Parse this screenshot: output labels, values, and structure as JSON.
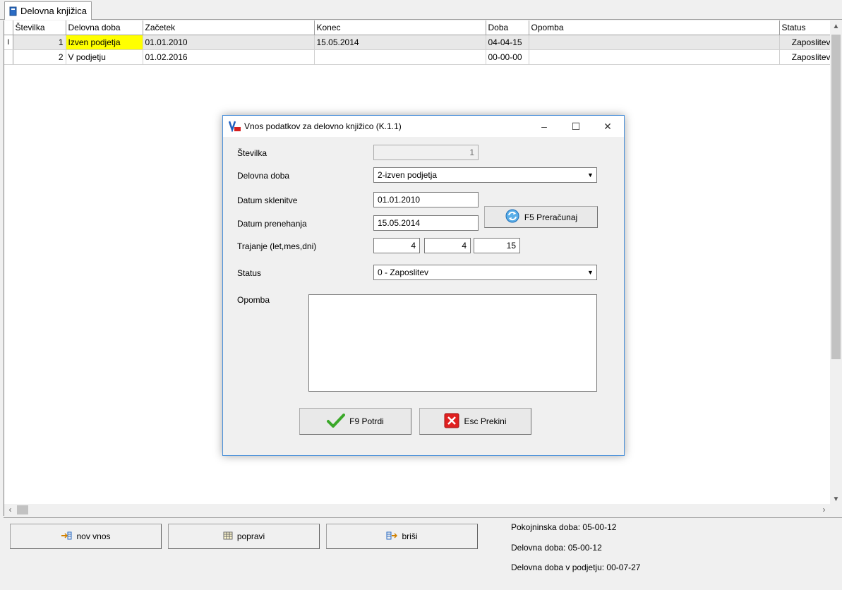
{
  "tab": {
    "label": "Delovna knjižica"
  },
  "grid": {
    "columns": [
      "Številka",
      "Delovna doba",
      "Začetek",
      "Konec",
      "Doba",
      "Opomba",
      "Status"
    ],
    "rows": [
      {
        "indicator": "I",
        "stevilka": "1",
        "delovna_doba": "Izven podjetja",
        "zacetek": "01.01.2010",
        "konec": "15.05.2014",
        "doba": "04-04-15",
        "opomba": "",
        "status": "Zaposlitev"
      },
      {
        "indicator": "",
        "stevilka": "2",
        "delovna_doba": "V podjetju",
        "zacetek": "01.02.2016",
        "konec": "",
        "doba": "00-00-00",
        "opomba": "",
        "status": "Zaposlitev"
      }
    ]
  },
  "bottom": {
    "btn_new": "nov vnos",
    "btn_edit": "popravi",
    "btn_delete": "briši",
    "pokojninska": "Pokojninska doba: 05-00-12",
    "delovna": "Delovna doba: 05-00-12",
    "delovna_podjetje": "Delovna doba v podjetju: 00-07-27"
  },
  "dialog": {
    "title": "Vnos podatkov za delovno knjižico  (K.1.1)",
    "lbl_stevilka": "Številka",
    "val_stevilka": "1",
    "lbl_delovna_doba": "Delovna doba",
    "val_delovna_doba": "2-izven podjetja",
    "lbl_datum_sklenitve": "Datum sklenitve",
    "val_datum_sklenitve": "01.01.2010",
    "lbl_datum_prenehanja": "Datum prenehanja",
    "val_datum_prenehanja": "15.05.2014",
    "btn_preracunaj": "F5 Preračunaj",
    "lbl_trajanje": "Trajanje (let,mes,dni)",
    "val_let": "4",
    "val_mes": "4",
    "val_dni": "15",
    "lbl_status": "Status",
    "val_status": "0 - Zaposlitev",
    "lbl_opomba": "Opomba",
    "val_opomba": "",
    "btn_potrdi": "F9 Potrdi",
    "btn_prekini": "Esc Prekini"
  },
  "colors": {
    "highlight": "#ffff00",
    "accent": "#4a90d9",
    "ok_green": "#3aa829",
    "cancel_red": "#e02020"
  }
}
